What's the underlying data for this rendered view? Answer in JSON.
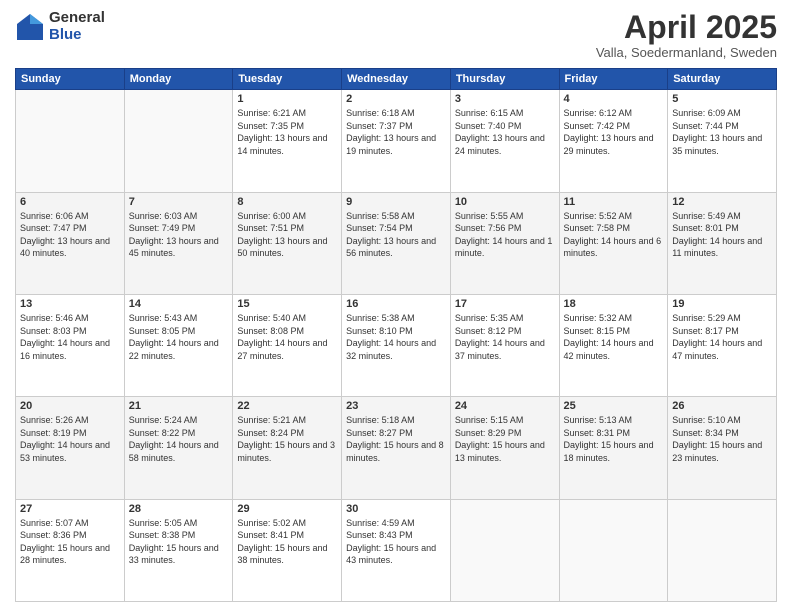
{
  "logo": {
    "general": "General",
    "blue": "Blue"
  },
  "header": {
    "month": "April 2025",
    "location": "Valla, Soedermanland, Sweden"
  },
  "weekdays": [
    "Sunday",
    "Monday",
    "Tuesday",
    "Wednesday",
    "Thursday",
    "Friday",
    "Saturday"
  ],
  "weeks": [
    [
      {
        "day": "",
        "sunrise": "",
        "sunset": "",
        "daylight": ""
      },
      {
        "day": "",
        "sunrise": "",
        "sunset": "",
        "daylight": ""
      },
      {
        "day": "1",
        "sunrise": "Sunrise: 6:21 AM",
        "sunset": "Sunset: 7:35 PM",
        "daylight": "Daylight: 13 hours and 14 minutes."
      },
      {
        "day": "2",
        "sunrise": "Sunrise: 6:18 AM",
        "sunset": "Sunset: 7:37 PM",
        "daylight": "Daylight: 13 hours and 19 minutes."
      },
      {
        "day": "3",
        "sunrise": "Sunrise: 6:15 AM",
        "sunset": "Sunset: 7:40 PM",
        "daylight": "Daylight: 13 hours and 24 minutes."
      },
      {
        "day": "4",
        "sunrise": "Sunrise: 6:12 AM",
        "sunset": "Sunset: 7:42 PM",
        "daylight": "Daylight: 13 hours and 29 minutes."
      },
      {
        "day": "5",
        "sunrise": "Sunrise: 6:09 AM",
        "sunset": "Sunset: 7:44 PM",
        "daylight": "Daylight: 13 hours and 35 minutes."
      }
    ],
    [
      {
        "day": "6",
        "sunrise": "Sunrise: 6:06 AM",
        "sunset": "Sunset: 7:47 PM",
        "daylight": "Daylight: 13 hours and 40 minutes."
      },
      {
        "day": "7",
        "sunrise": "Sunrise: 6:03 AM",
        "sunset": "Sunset: 7:49 PM",
        "daylight": "Daylight: 13 hours and 45 minutes."
      },
      {
        "day": "8",
        "sunrise": "Sunrise: 6:00 AM",
        "sunset": "Sunset: 7:51 PM",
        "daylight": "Daylight: 13 hours and 50 minutes."
      },
      {
        "day": "9",
        "sunrise": "Sunrise: 5:58 AM",
        "sunset": "Sunset: 7:54 PM",
        "daylight": "Daylight: 13 hours and 56 minutes."
      },
      {
        "day": "10",
        "sunrise": "Sunrise: 5:55 AM",
        "sunset": "Sunset: 7:56 PM",
        "daylight": "Daylight: 14 hours and 1 minute."
      },
      {
        "day": "11",
        "sunrise": "Sunrise: 5:52 AM",
        "sunset": "Sunset: 7:58 PM",
        "daylight": "Daylight: 14 hours and 6 minutes."
      },
      {
        "day": "12",
        "sunrise": "Sunrise: 5:49 AM",
        "sunset": "Sunset: 8:01 PM",
        "daylight": "Daylight: 14 hours and 11 minutes."
      }
    ],
    [
      {
        "day": "13",
        "sunrise": "Sunrise: 5:46 AM",
        "sunset": "Sunset: 8:03 PM",
        "daylight": "Daylight: 14 hours and 16 minutes."
      },
      {
        "day": "14",
        "sunrise": "Sunrise: 5:43 AM",
        "sunset": "Sunset: 8:05 PM",
        "daylight": "Daylight: 14 hours and 22 minutes."
      },
      {
        "day": "15",
        "sunrise": "Sunrise: 5:40 AM",
        "sunset": "Sunset: 8:08 PM",
        "daylight": "Daylight: 14 hours and 27 minutes."
      },
      {
        "day": "16",
        "sunrise": "Sunrise: 5:38 AM",
        "sunset": "Sunset: 8:10 PM",
        "daylight": "Daylight: 14 hours and 32 minutes."
      },
      {
        "day": "17",
        "sunrise": "Sunrise: 5:35 AM",
        "sunset": "Sunset: 8:12 PM",
        "daylight": "Daylight: 14 hours and 37 minutes."
      },
      {
        "day": "18",
        "sunrise": "Sunrise: 5:32 AM",
        "sunset": "Sunset: 8:15 PM",
        "daylight": "Daylight: 14 hours and 42 minutes."
      },
      {
        "day": "19",
        "sunrise": "Sunrise: 5:29 AM",
        "sunset": "Sunset: 8:17 PM",
        "daylight": "Daylight: 14 hours and 47 minutes."
      }
    ],
    [
      {
        "day": "20",
        "sunrise": "Sunrise: 5:26 AM",
        "sunset": "Sunset: 8:19 PM",
        "daylight": "Daylight: 14 hours and 53 minutes."
      },
      {
        "day": "21",
        "sunrise": "Sunrise: 5:24 AM",
        "sunset": "Sunset: 8:22 PM",
        "daylight": "Daylight: 14 hours and 58 minutes."
      },
      {
        "day": "22",
        "sunrise": "Sunrise: 5:21 AM",
        "sunset": "Sunset: 8:24 PM",
        "daylight": "Daylight: 15 hours and 3 minutes."
      },
      {
        "day": "23",
        "sunrise": "Sunrise: 5:18 AM",
        "sunset": "Sunset: 8:27 PM",
        "daylight": "Daylight: 15 hours and 8 minutes."
      },
      {
        "day": "24",
        "sunrise": "Sunrise: 5:15 AM",
        "sunset": "Sunset: 8:29 PM",
        "daylight": "Daylight: 15 hours and 13 minutes."
      },
      {
        "day": "25",
        "sunrise": "Sunrise: 5:13 AM",
        "sunset": "Sunset: 8:31 PM",
        "daylight": "Daylight: 15 hours and 18 minutes."
      },
      {
        "day": "26",
        "sunrise": "Sunrise: 5:10 AM",
        "sunset": "Sunset: 8:34 PM",
        "daylight": "Daylight: 15 hours and 23 minutes."
      }
    ],
    [
      {
        "day": "27",
        "sunrise": "Sunrise: 5:07 AM",
        "sunset": "Sunset: 8:36 PM",
        "daylight": "Daylight: 15 hours and 28 minutes."
      },
      {
        "day": "28",
        "sunrise": "Sunrise: 5:05 AM",
        "sunset": "Sunset: 8:38 PM",
        "daylight": "Daylight: 15 hours and 33 minutes."
      },
      {
        "day": "29",
        "sunrise": "Sunrise: 5:02 AM",
        "sunset": "Sunset: 8:41 PM",
        "daylight": "Daylight: 15 hours and 38 minutes."
      },
      {
        "day": "30",
        "sunrise": "Sunrise: 4:59 AM",
        "sunset": "Sunset: 8:43 PM",
        "daylight": "Daylight: 15 hours and 43 minutes."
      },
      {
        "day": "",
        "sunrise": "",
        "sunset": "",
        "daylight": ""
      },
      {
        "day": "",
        "sunrise": "",
        "sunset": "",
        "daylight": ""
      },
      {
        "day": "",
        "sunrise": "",
        "sunset": "",
        "daylight": ""
      }
    ]
  ]
}
